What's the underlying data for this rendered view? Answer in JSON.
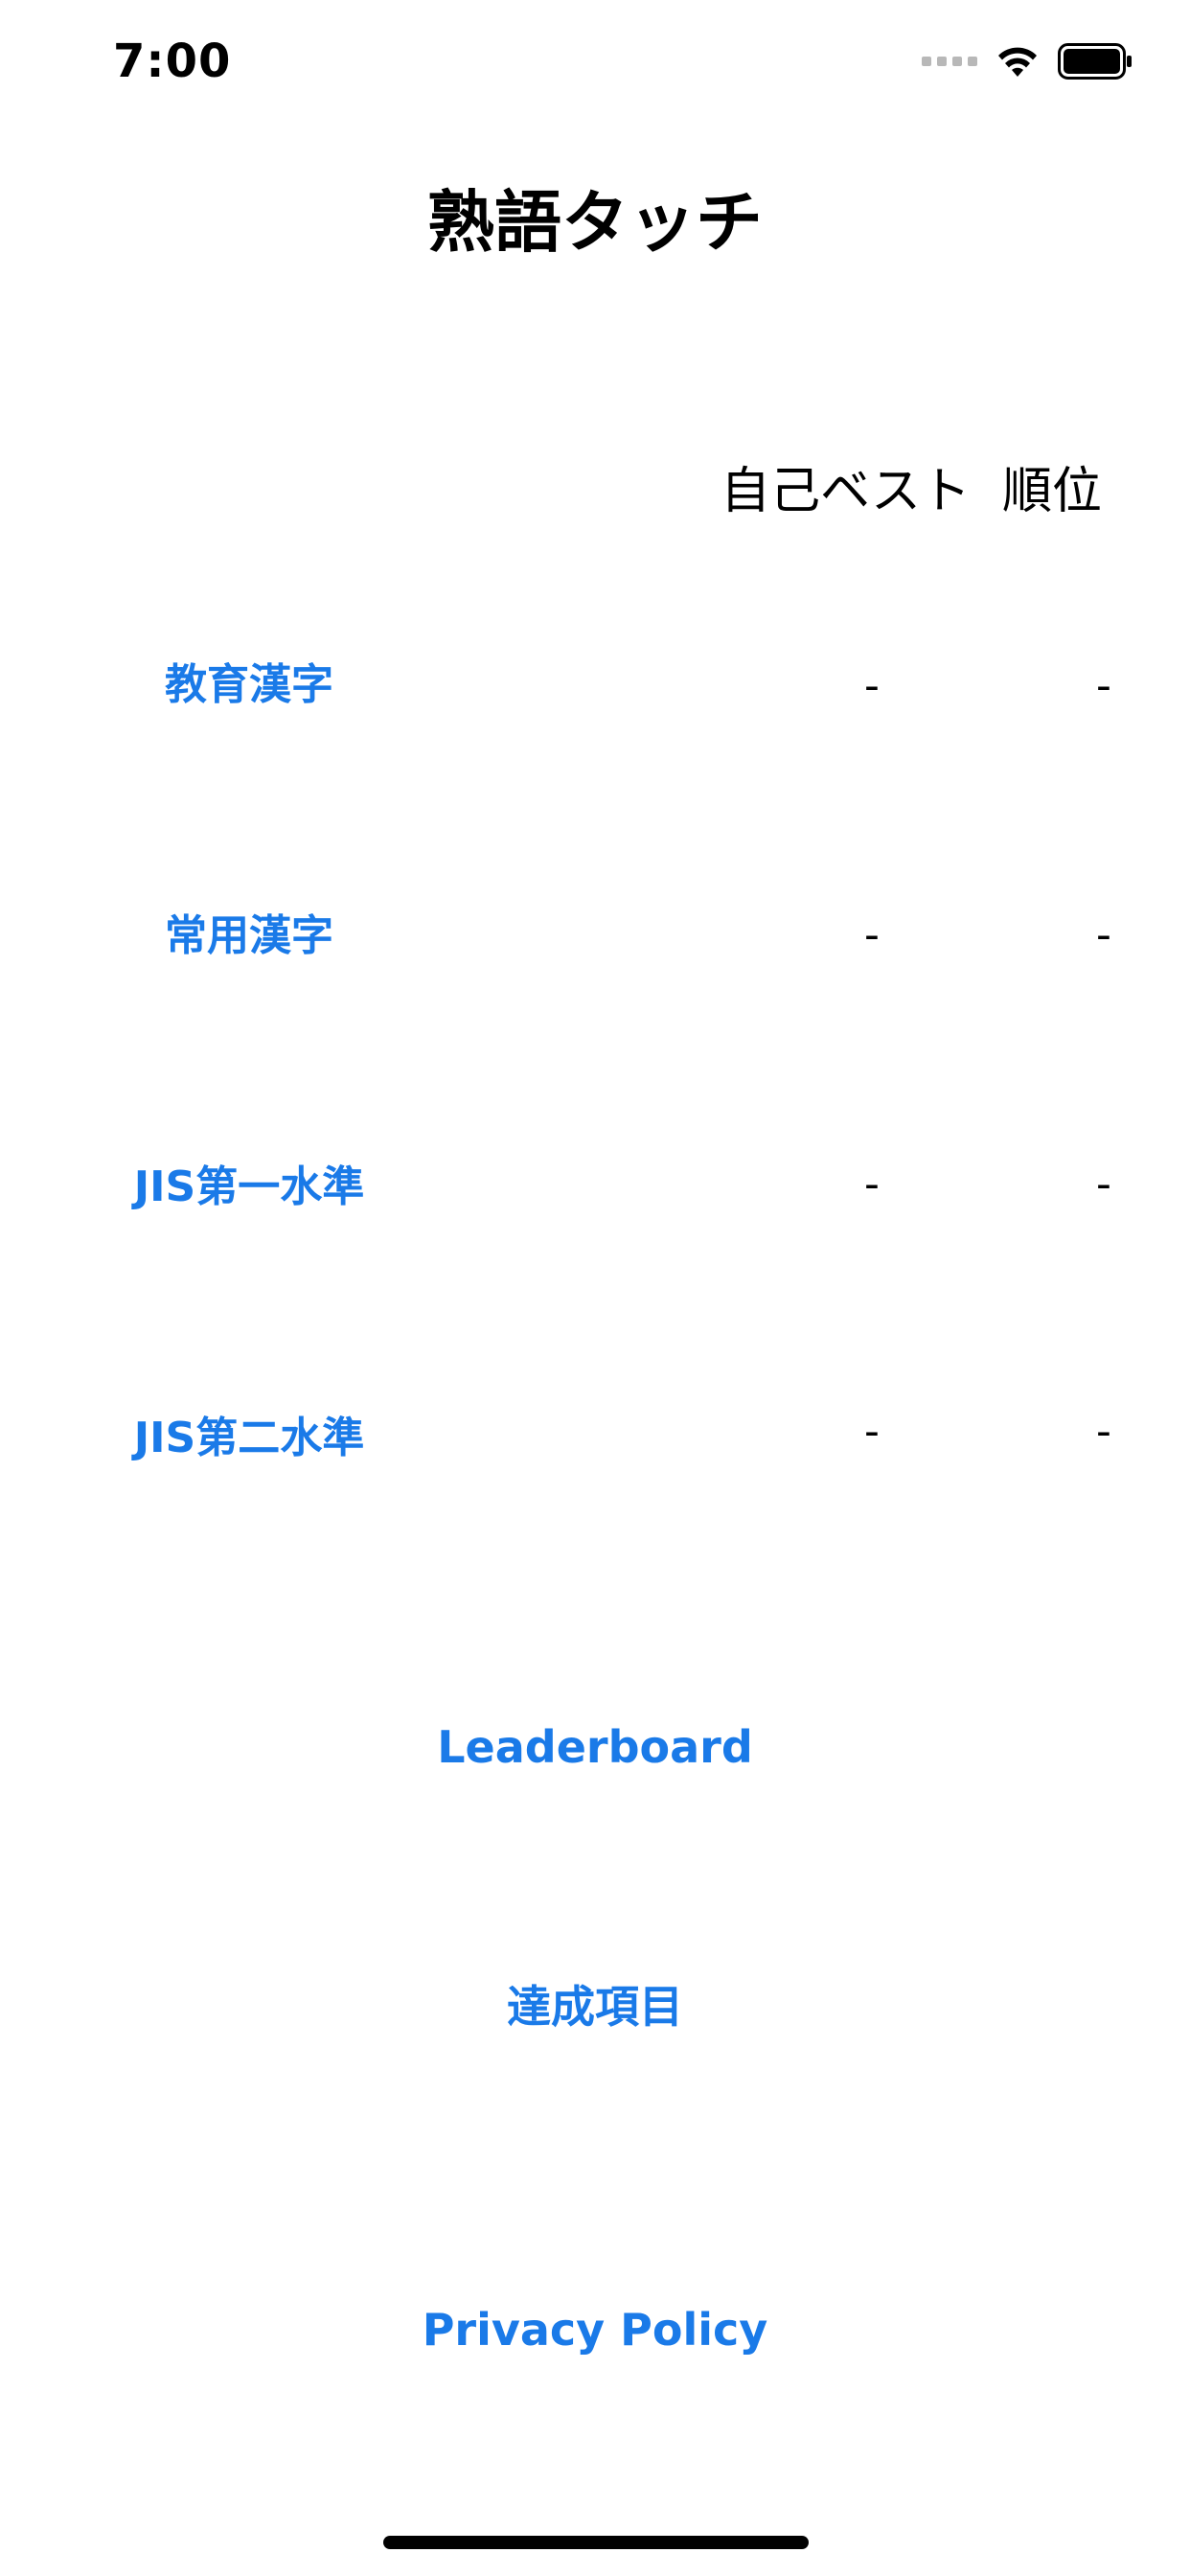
{
  "status_bar": {
    "time": "7:00",
    "icons": [
      "signal-dots-icon",
      "wifi-icon",
      "battery-icon"
    ]
  },
  "header": {
    "title": "熟語タッチ"
  },
  "table": {
    "columns": [
      "自己ベスト",
      "順位"
    ],
    "rows": [
      {
        "label": "教育漢字",
        "best": "-",
        "rank": "-"
      },
      {
        "label": "常用漢字",
        "best": "-",
        "rank": "-"
      },
      {
        "label": "JIS第一水準",
        "best": "-",
        "rank": "-"
      },
      {
        "label": "JIS第二水準",
        "best": "-",
        "rank": "-"
      }
    ]
  },
  "actions": {
    "leaderboard": "Leaderboard",
    "achievements": "達成項目",
    "privacy_policy": "Privacy Policy"
  },
  "colors": {
    "accent": "#1a7ae8",
    "text": "#000000",
    "background": "#ffffff"
  }
}
